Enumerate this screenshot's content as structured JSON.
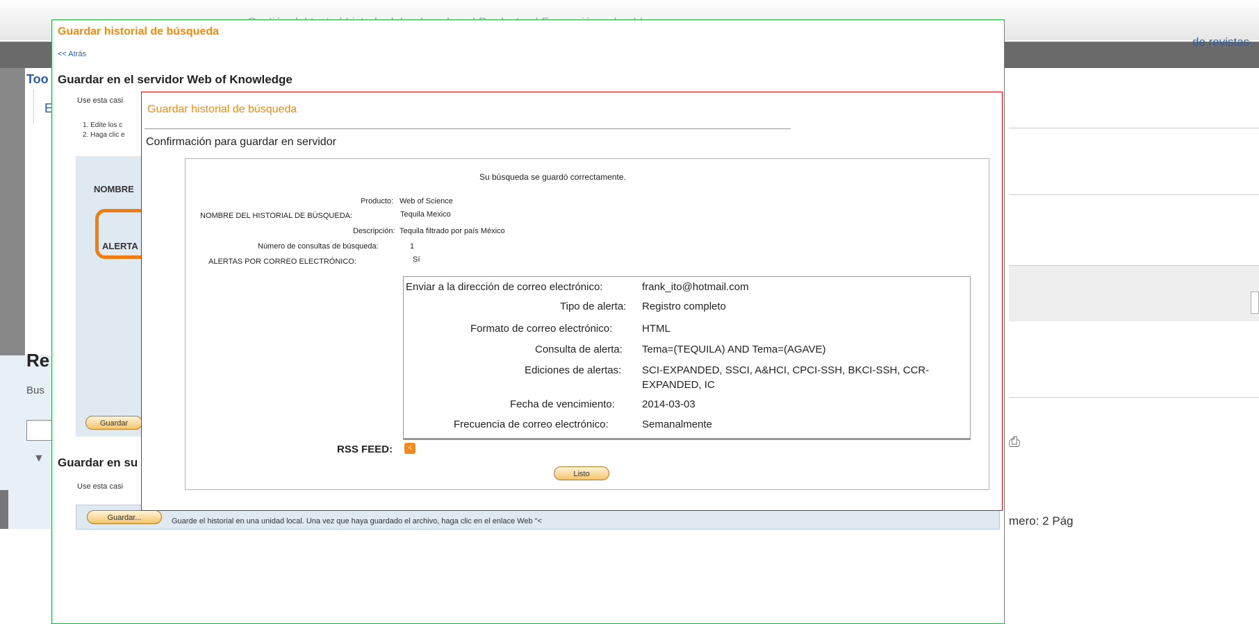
{
  "background": {
    "nav_links": "Gestión del texto   |   Listado del ordenador...   |   Productos   |   Formación ...   |   ...   |   Ir",
    "nav_right": "de revistas",
    "tab_partial": "Too",
    "letter_partial": "E",
    "results_partial": "Re",
    "search_partial": "Bus",
    "numero": "mero: 2  Pág"
  },
  "outer_dialog": {
    "title": "Guardar historial de búsqueda",
    "back_link": "<< Atrás",
    "server_heading": "Guardar en el servidor Web of Knowledge",
    "server_intro": "Use esta casi",
    "step1": "1. Edite los c",
    "step2": "2. Haga clic e",
    "label_nombre": "NOMBRE",
    "label_alertas": "ALERTA",
    "save_button": "Guardar",
    "local_heading": "Guardar en su",
    "local_intro": "Use esta casi",
    "local_save_button": "Guardar...",
    "local_save_text": "Guarde el historial en una unidad local. Una vez que haya guardado el archivo, haga clic en el enlace Web \"<"
  },
  "confirm_dialog": {
    "title": "Guardar historial de búsqueda",
    "heading": "Confirmación para guardar en servidor",
    "success_message": "Su búsqueda se guardó correctamente.",
    "summary": [
      {
        "label": "Producto:",
        "value": "Web of Science"
      },
      {
        "label": "NOMBRE DEL HISTORIAL DE BÚSQUEDA:",
        "value": "Tequila Mexico"
      },
      {
        "label": "Descripción:",
        "value": "Tequila filtrado por país México"
      },
      {
        "label": "Número de consultas de búsqueda:",
        "value": "1"
      },
      {
        "label": "ALERTAS POR CORREO ELECTRÓNICO:",
        "value": "Sí"
      }
    ],
    "alert_details": [
      {
        "label": "Enviar a la dirección de correo electrónico:",
        "value": "frank_ito@hotmail.com"
      },
      {
        "label": "Tipo de alerta:",
        "value": "Registro completo"
      },
      {
        "label": "Formato de correo electrónico:",
        "value": "HTML"
      },
      {
        "label": "Consulta de alerta:",
        "value": "Tema=(TEQUILA) AND Tema=(AGAVE)"
      },
      {
        "label": "Ediciones de alertas:",
        "value": "SCI-EXPANDED, SSCI, A&HCI, CPCI-SSH, BKCI-SSH, CCR-",
        "value2": "EXPANDED, IC"
      },
      {
        "label": "Fecha de vencimiento:",
        "value": "2014-03-03"
      },
      {
        "label": "Frecuencia de correo electrónico:",
        "value": "Semanalmente"
      }
    ],
    "rss_label": "RSS FEED:",
    "done_button": "Listo"
  },
  "colors": {
    "accent_orange": "#f08a10",
    "outer_border": "#1db33a",
    "inner_border": "#e01010",
    "link_blue": "#2a5db0"
  }
}
